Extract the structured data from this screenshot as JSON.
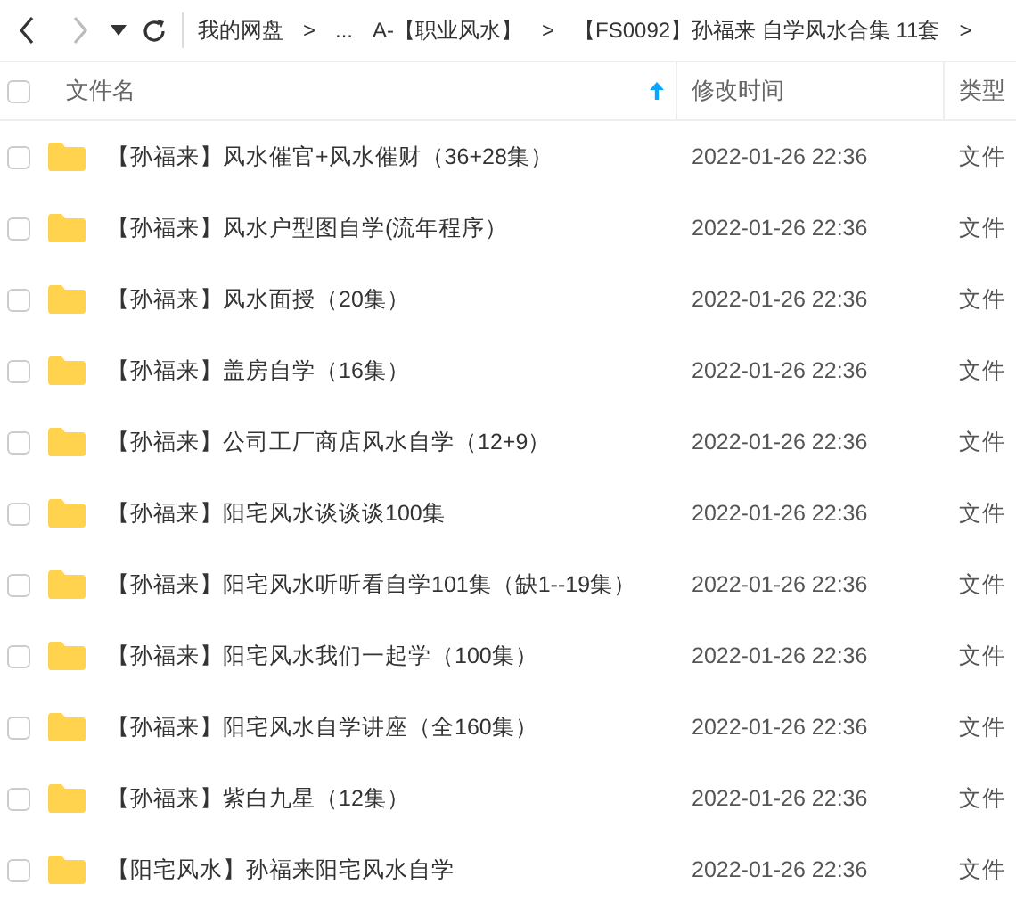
{
  "toolbar": {
    "breadcrumbs": [
      "我的网盘",
      ">",
      "...",
      "A-【职业风水】",
      ">",
      "【FS0092】孙福来 自学风水合集 11套",
      ">"
    ]
  },
  "table": {
    "select_all_checked": false,
    "columns": [
      {
        "label": "文件名",
        "sorted": true
      },
      {
        "label": "修改时间",
        "sorted": false
      },
      {
        "label": "类型",
        "sorted": false
      }
    ],
    "rows": [
      {
        "name": "【孙福来】风水催官+风水催财（36+28集）",
        "modified": "2022-01-26 22:36",
        "type": "文件",
        "checked": false
      },
      {
        "name": "【孙福来】风水户型图自学(流年程序）",
        "modified": "2022-01-26 22:36",
        "type": "文件",
        "checked": false
      },
      {
        "name": "【孙福来】风水面授（20集）",
        "modified": "2022-01-26 22:36",
        "type": "文件",
        "checked": false
      },
      {
        "name": "【孙福来】盖房自学（16集）",
        "modified": "2022-01-26 22:36",
        "type": "文件",
        "checked": false
      },
      {
        "name": "【孙福来】公司工厂商店风水自学（12+9）",
        "modified": "2022-01-26 22:36",
        "type": "文件",
        "checked": false
      },
      {
        "name": "【孙福来】阳宅风水谈谈谈100集",
        "modified": "2022-01-26 22:36",
        "type": "文件",
        "checked": false
      },
      {
        "name": "【孙福来】阳宅风水听听看自学101集（缺1--19集）",
        "modified": "2022-01-26 22:36",
        "type": "文件",
        "checked": false
      },
      {
        "name": "【孙福来】阳宅风水我们一起学（100集）",
        "modified": "2022-01-26 22:36",
        "type": "文件",
        "checked": false
      },
      {
        "name": "【孙福来】阳宅风水自学讲座（全160集）",
        "modified": "2022-01-26 22:36",
        "type": "文件",
        "checked": false
      },
      {
        "name": "【孙福来】紫白九星（12集）",
        "modified": "2022-01-26 22:36",
        "type": "文件",
        "checked": false
      },
      {
        "name": "【阳宅风水】孙福来阳宅风水自学",
        "modified": "2022-01-26 22:36",
        "type": "文件",
        "checked": false
      }
    ]
  }
}
